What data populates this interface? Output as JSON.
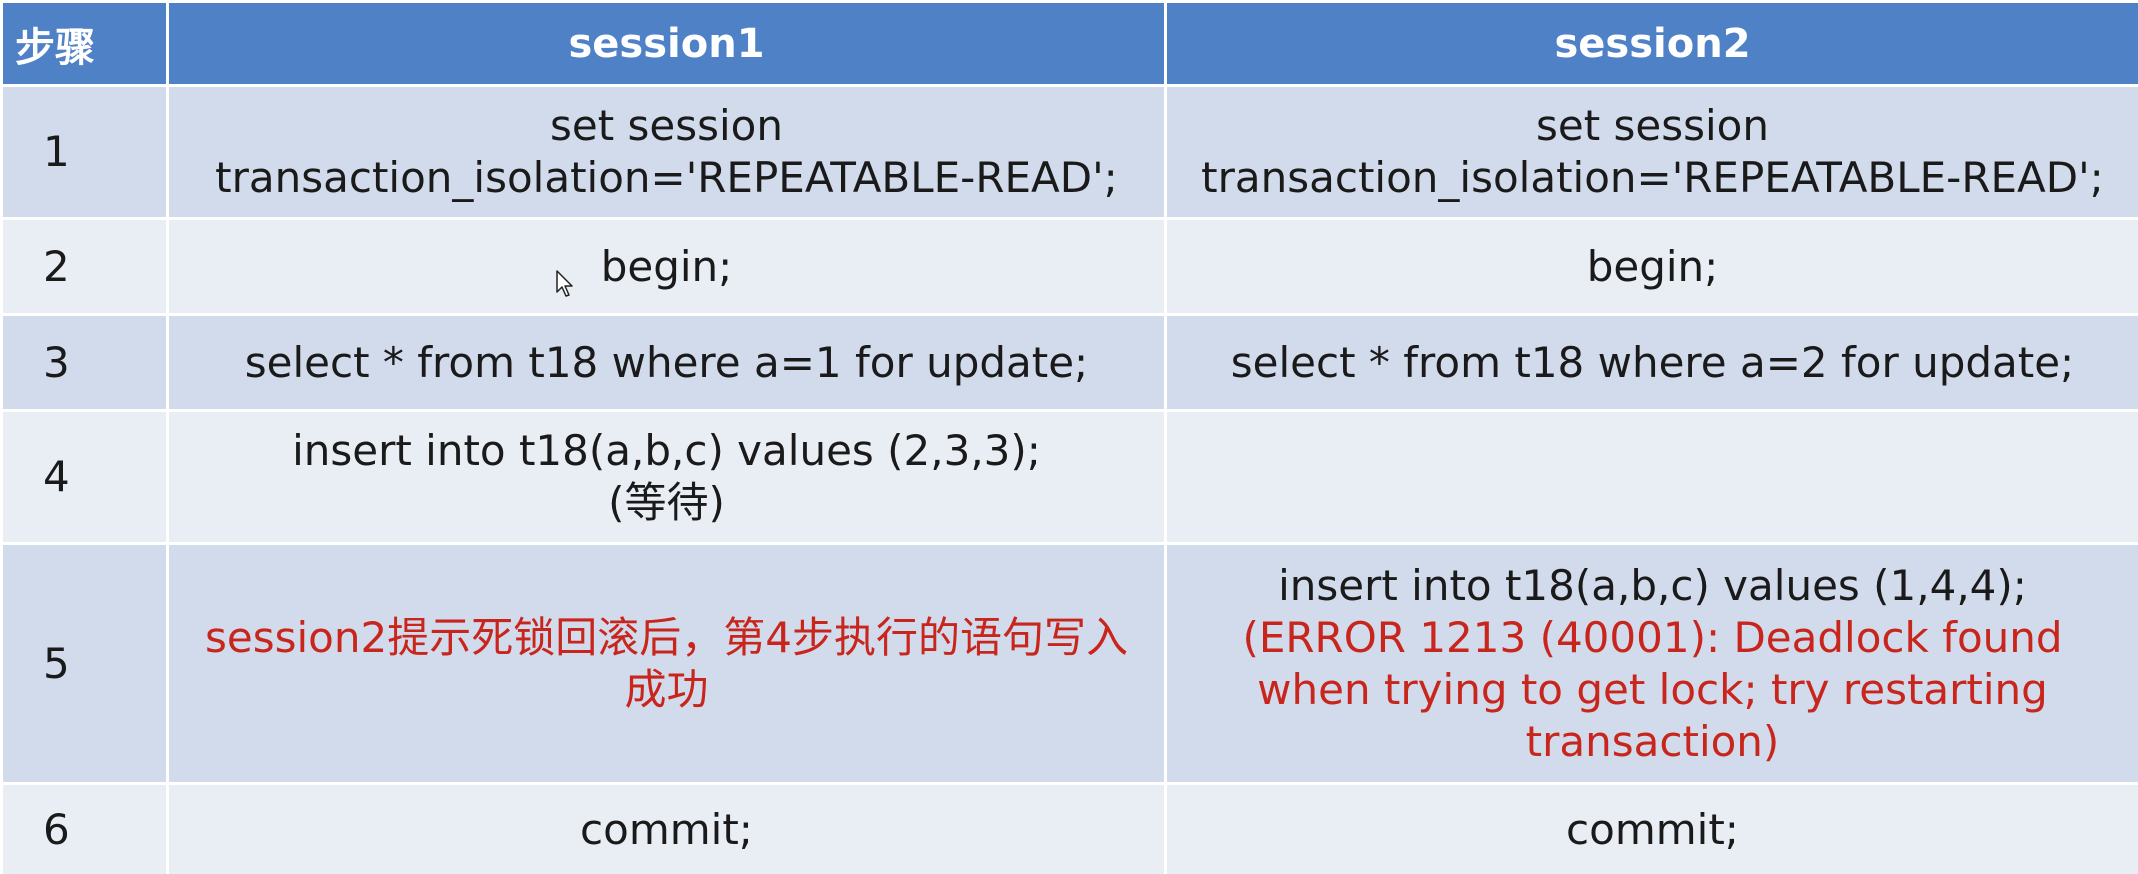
{
  "header": {
    "step": "步骤",
    "session1": "session1",
    "session2": "session2"
  },
  "rows": [
    {
      "step": "1",
      "session1": [
        "set session",
        "transaction_isolation='REPEATABLE-READ';"
      ],
      "session2": [
        "set session",
        "transaction_isolation='REPEATABLE-READ';"
      ]
    },
    {
      "step": "2",
      "session1": [
        "begin;"
      ],
      "session2": [
        "begin;"
      ]
    },
    {
      "step": "3",
      "session1": [
        "select * from t18 where a=1 for update;"
      ],
      "session2": [
        "select * from t18 where a=2 for update;"
      ]
    },
    {
      "step": "4",
      "session1": [
        "insert into t18(a,b,c) values (2,3,3);",
        "(等待)"
      ],
      "session2": []
    },
    {
      "step": "5",
      "session1_red": "session2提示死锁回滚后，第4步执行的语句写入成功",
      "session2": [
        "insert into t18(a,b,c) values (1,4,4);"
      ],
      "session2_red": [
        "(ERROR 1213 (40001): Deadlock found",
        "when trying to get lock; try restarting",
        "transaction)"
      ]
    },
    {
      "step": "6",
      "session1": [
        "commit;"
      ],
      "session2": [
        "commit;"
      ]
    }
  ],
  "colors": {
    "header_bg": "#4f81c6",
    "row_dark": "#d2dbeb",
    "row_light": "#e9edf4",
    "highlight_text": "#c8261c"
  },
  "icons": [
    "mouse-cursor-icon"
  ]
}
